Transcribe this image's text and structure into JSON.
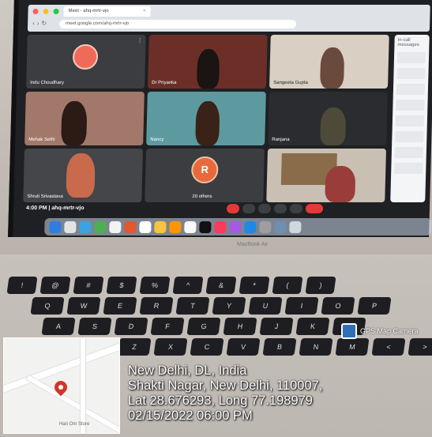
{
  "browser": {
    "tab_title": "Meet - ahq-mrtr-vjo",
    "address": "meet.google.com/ahq-mrtr-vjo"
  },
  "meet": {
    "participants": [
      {
        "name": "Indu Choudhary"
      },
      {
        "name": "Dr Priyanka"
      },
      {
        "name": "Sangeeta Gupta"
      },
      {
        "name": "Mehak Sethi"
      },
      {
        "name": "Nancy"
      },
      {
        "name": "Ranjana"
      },
      {
        "name": "Shruti Srivastava"
      },
      {
        "name": "20 others"
      },
      {
        "name": ""
      }
    ],
    "avatar_letter": "R",
    "bottom_info": "4:00 PM | ahq-mrtr-vjo",
    "side_panel_title": "In-call messages"
  },
  "laptop": {
    "brand": "MacBook Air",
    "keys_row1": [
      "!",
      "@",
      "#",
      "$",
      "%",
      "^",
      "&",
      "*",
      "(",
      ")"
    ],
    "keys_row2": [
      "Q",
      "W",
      "E",
      "R",
      "T",
      "Y",
      "U",
      "I",
      "O",
      "P"
    ],
    "keys_row3": [
      "A",
      "S",
      "D",
      "F",
      "G",
      "H",
      "J",
      "K",
      "L"
    ],
    "keys_row4": [
      "Z",
      "X",
      "C",
      "V",
      "B",
      "N",
      "M",
      "<",
      ">"
    ]
  },
  "gps": {
    "app_name": "GPS Map Camera",
    "line1": "New Delhi, DL, India",
    "line2": "Shakti Nagar, New Delhi, 110007,",
    "line3": "Lat 28.676293, Long 77.198979",
    "line4": "02/15/2022 06:00 PM",
    "map_label": "Hari Om Store"
  },
  "colors": {
    "meet_bg": "#1f2023",
    "end_call": "#e53935",
    "map_pin": "#d2342b"
  }
}
